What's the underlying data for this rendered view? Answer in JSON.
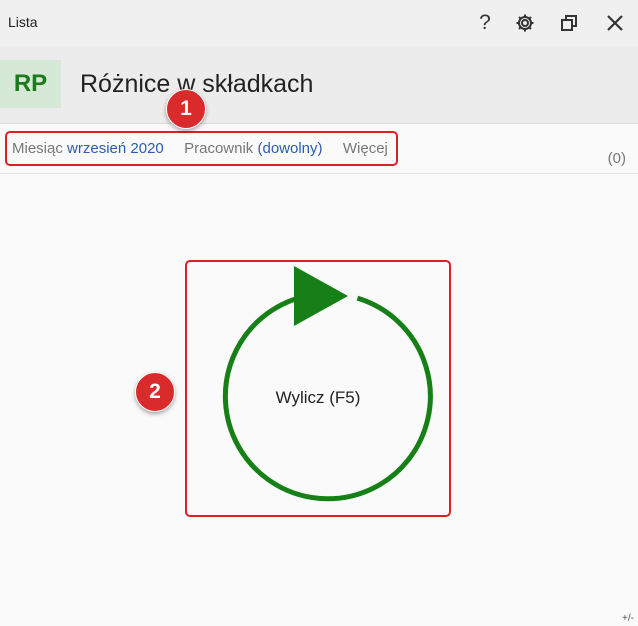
{
  "window": {
    "title": "Lista",
    "buttons": [
      {
        "name": "help-icon",
        "glyph": "?"
      },
      {
        "name": "gear-icon",
        "glyph": "gear"
      },
      {
        "name": "restore-icon",
        "glyph": "restore"
      },
      {
        "name": "close-icon",
        "glyph": "close"
      }
    ]
  },
  "header": {
    "badge": "RP",
    "title": "Różnice w składkach"
  },
  "filters": {
    "month_label": "Miesiąc",
    "month_value": "wrzesień 2020",
    "employee_label": "Pracownik",
    "employee_value": "(dowolny)",
    "more_label": "Więcej",
    "count": "(0)"
  },
  "main": {
    "calculate_label": "Wylicz (F5)"
  },
  "callouts": [
    "1",
    "2"
  ],
  "footer": {
    "corner": "+/-"
  },
  "colors": {
    "accent_green": "#168016",
    "badge_bg": "#d6e8d6",
    "link_blue": "#2a5db0",
    "callout_red": "#d92b2b"
  }
}
